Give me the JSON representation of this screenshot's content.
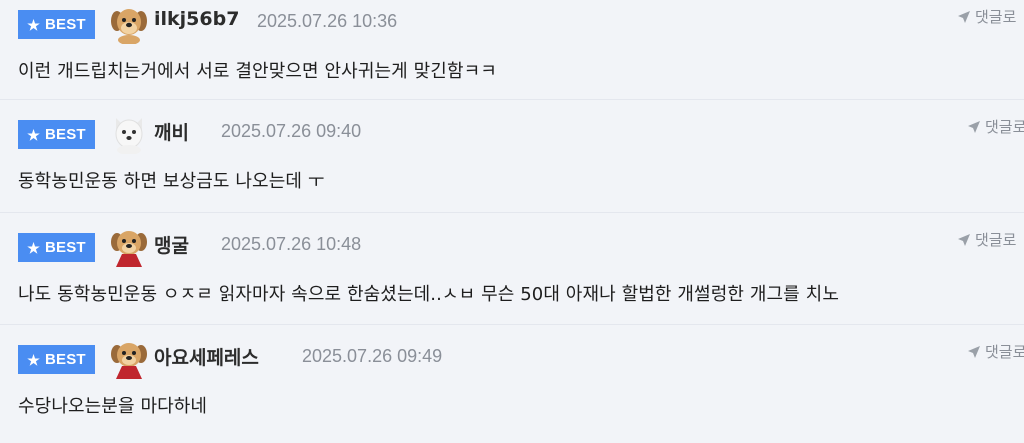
{
  "badge": {
    "label": "BEST",
    "icon": "star-icon"
  },
  "reply_label": "댓글로",
  "comments": [
    {
      "nickname": "ilkj56b7",
      "date": "2025.07.26 10:36",
      "text": "이런 개드립치는거에서 서로 결안맞으면 안사귀는게 맞긴함ㅋㅋ",
      "avatar": "puppy-avatar"
    },
    {
      "nickname": "깨비",
      "date": "2025.07.26 09:40",
      "text": "동학농민운동 하면 보상금도 나오는데 ㅜ",
      "avatar": "white-dog-avatar"
    },
    {
      "nickname": "맹굴",
      "date": "2025.07.26 10:48",
      "text": "나도 동학농민운동 ㅇㅈㄹ 읽자마자 속으로 한숨셨는데..ㅅㅂ 무슨 50대 아재나 할법한 개썰렁한 개그를 치노",
      "avatar": "puppy-cape-avatar"
    },
    {
      "nickname": "아요세페레스",
      "date": "2025.07.26 09:49",
      "text": "수당나오는분을 마다하네",
      "avatar": "puppy-cape-avatar"
    }
  ]
}
